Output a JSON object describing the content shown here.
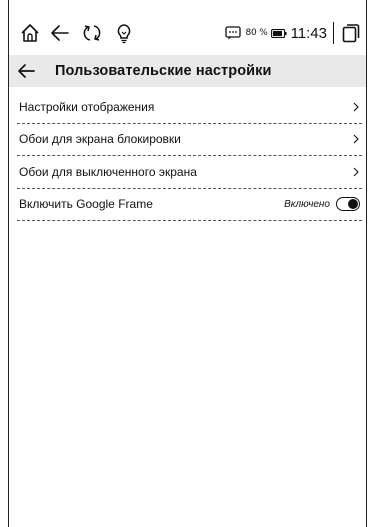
{
  "status_bar": {
    "icons": [
      "home-icon",
      "back-arrow-icon",
      "refresh-icon",
      "lightbulb-icon"
    ],
    "battery_percent": "80 %",
    "time": "11:43"
  },
  "header": {
    "title": "Пользовательские настройки"
  },
  "settings": {
    "items": [
      {
        "label": "Настройки отображения",
        "type": "nav"
      },
      {
        "label": "Обои для экрана блокировки",
        "type": "nav"
      },
      {
        "label": "Обои для выключенного экрана",
        "type": "nav"
      },
      {
        "label": "Включить Google Frame",
        "type": "toggle",
        "status": "Включено",
        "enabled": true
      }
    ]
  },
  "colors": {
    "header_bg": "#e9e9e9",
    "text": "#111111"
  }
}
